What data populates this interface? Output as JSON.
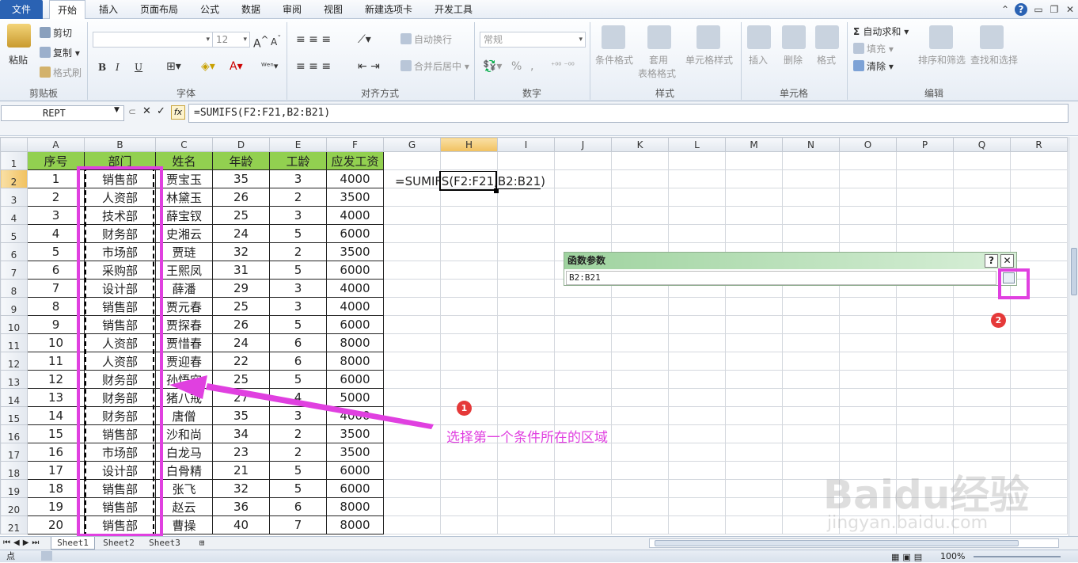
{
  "menu": {
    "file": "文件",
    "tabs": [
      "开始",
      "插入",
      "页面布局",
      "公式",
      "数据",
      "审阅",
      "视图",
      "新建选项卡",
      "开发工具"
    ]
  },
  "ribbon": {
    "clipboard": {
      "paste": "粘贴",
      "cut": "剪切",
      "copy": "复制",
      "format_painter": "格式刷",
      "label": "剪贴板"
    },
    "font": {
      "size": "12",
      "label": "字体",
      "bold": "B",
      "italic": "I",
      "underline": "U"
    },
    "alignment": {
      "wrap": "自动换行",
      "merge": "合并后居中",
      "label": "对齐方式"
    },
    "number": {
      "format": "常规",
      "percent": "%",
      "label": "数字"
    },
    "styles": {
      "conditional": "条件格式",
      "table_format_1": "套用",
      "table_format_2": "表格格式",
      "cell_styles": "单元格样式",
      "label": "样式"
    },
    "cells": {
      "insert": "插入",
      "delete": "删除",
      "format": "格式",
      "label": "单元格"
    },
    "editing": {
      "autosum": "自动求和",
      "fill": "填充",
      "clear": "清除",
      "sort": "排序和筛选",
      "find": "查找和选择",
      "label": "编辑"
    }
  },
  "formula_bar": {
    "name_box": "REPT",
    "fx": "fx",
    "formula": "=SUMIFS(F2:F21,B2:B21)"
  },
  "grid": {
    "columns": [
      "A",
      "B",
      "C",
      "D",
      "E",
      "F",
      "G",
      "H",
      "I",
      "J",
      "K",
      "L",
      "M",
      "N",
      "O",
      "P",
      "Q",
      "R"
    ],
    "headers": [
      "序号",
      "部门",
      "姓名",
      "年龄",
      "工龄",
      "应发工资"
    ],
    "rows": [
      [
        "1",
        "销售部",
        "贾宝玉",
        "35",
        "3",
        "4000"
      ],
      [
        "2",
        "人资部",
        "林黛玉",
        "26",
        "2",
        "3500"
      ],
      [
        "3",
        "技术部",
        "薛宝钗",
        "25",
        "3",
        "4000"
      ],
      [
        "4",
        "财务部",
        "史湘云",
        "24",
        "5",
        "6000"
      ],
      [
        "5",
        "市场部",
        "贾琏",
        "32",
        "2",
        "3500"
      ],
      [
        "6",
        "采购部",
        "王熙凤",
        "31",
        "5",
        "6000"
      ],
      [
        "7",
        "设计部",
        "薛潘",
        "29",
        "3",
        "4000"
      ],
      [
        "8",
        "销售部",
        "贾元春",
        "25",
        "3",
        "4000"
      ],
      [
        "9",
        "销售部",
        "贾探春",
        "26",
        "5",
        "6000"
      ],
      [
        "10",
        "人资部",
        "贾惜春",
        "24",
        "6",
        "8000"
      ],
      [
        "11",
        "人资部",
        "贾迎春",
        "22",
        "6",
        "8000"
      ],
      [
        "12",
        "财务部",
        "孙悟空",
        "25",
        "5",
        "6000"
      ],
      [
        "13",
        "财务部",
        "猪八戒",
        "27",
        "4",
        "5000"
      ],
      [
        "14",
        "财务部",
        "唐僧",
        "35",
        "3",
        "4000"
      ],
      [
        "15",
        "销售部",
        "沙和尚",
        "34",
        "2",
        "3500"
      ],
      [
        "16",
        "市场部",
        "白龙马",
        "23",
        "2",
        "3500"
      ],
      [
        "17",
        "设计部",
        "白骨精",
        "21",
        "5",
        "6000"
      ],
      [
        "18",
        "销售部",
        "张飞",
        "32",
        "5",
        "6000"
      ],
      [
        "19",
        "销售部",
        "赵云",
        "36",
        "6",
        "8000"
      ],
      [
        "20",
        "销售部",
        "曹操",
        "40",
        "7",
        "8000"
      ]
    ],
    "cell_formula_prefix": "=SUMIFS(F2:F21,",
    "cell_formula_arg": "B2:B21",
    "cell_formula_suffix": ")"
  },
  "dialog": {
    "title": "函数参数",
    "help": "?",
    "close": "✕",
    "input_value": "B2:B21"
  },
  "annotations": {
    "marker1": "1",
    "marker2": "2",
    "text": "选择第一个条件所在的区域"
  },
  "sheets": [
    "Sheet1",
    "Sheet2",
    "Sheet3"
  ],
  "status": {
    "mode": "点",
    "zoom": "100%"
  },
  "watermark": {
    "main": "Baidu经验",
    "sub": "jingyan.baidu.com"
  },
  "colors": {
    "header_fill": "#92d050",
    "annotation": "#e040e0",
    "marker": "#e53939"
  }
}
